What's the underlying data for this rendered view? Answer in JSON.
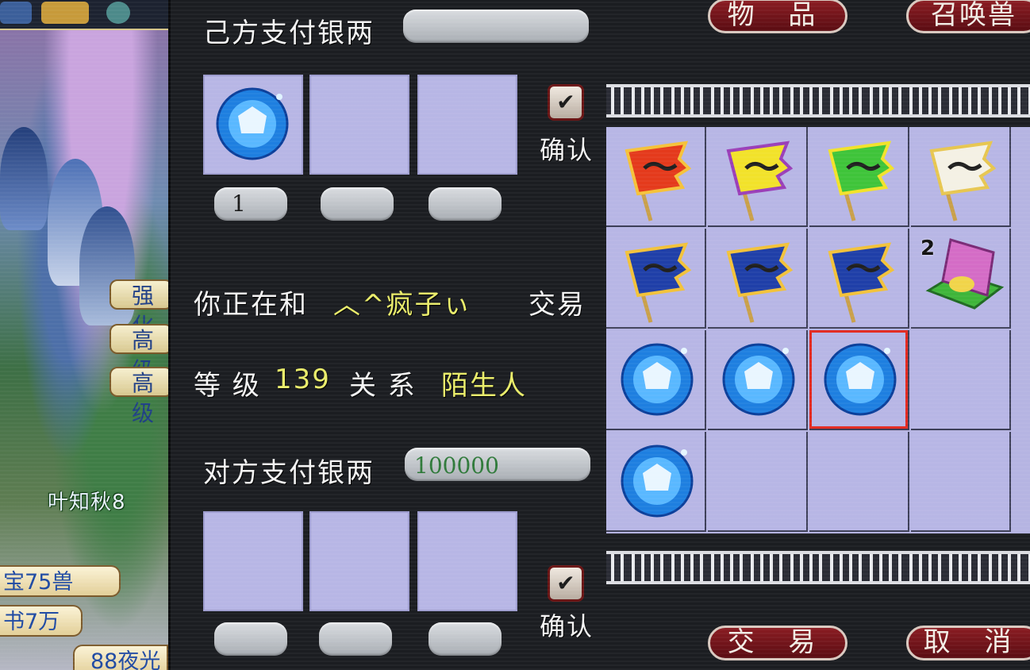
{
  "trade": {
    "self_pay_label": "己方支付银两",
    "self_pay_value": "",
    "self_slots": [
      {
        "item": "gem",
        "qty": "1"
      },
      {
        "item": "",
        "qty": ""
      },
      {
        "item": "",
        "qty": ""
      }
    ],
    "confirm_label": "确认",
    "trading_prefix": "你正在和",
    "partner_name": "︿^疯子ぃ",
    "trading_suffix": "交易",
    "level_label": "等 级",
    "level_value": "139",
    "relation_label": "关 系",
    "relation_value": "陌生人",
    "other_pay_label": "对方支付银两",
    "other_pay_value": "100000",
    "other_slots": [
      {
        "item": "",
        "qty": ""
      },
      {
        "item": "",
        "qty": ""
      },
      {
        "item": "",
        "qty": ""
      }
    ]
  },
  "tabs": {
    "items": "物 品",
    "pets": "召唤兽"
  },
  "buttons": {
    "trade": "交 易",
    "cancel": "取 消"
  },
  "inventory": {
    "cells": [
      {
        "item": "flag-red",
        "count": ""
      },
      {
        "item": "flag-yellow",
        "count": ""
      },
      {
        "item": "flag-green",
        "count": ""
      },
      {
        "item": "flag-white",
        "count": ""
      },
      {
        "item": "flag-blue",
        "count": ""
      },
      {
        "item": "flag-blue",
        "count": ""
      },
      {
        "item": "flag-blue",
        "count": ""
      },
      {
        "item": "gift-box",
        "count": "2"
      },
      {
        "item": "gem",
        "count": ""
      },
      {
        "item": "gem",
        "count": ""
      },
      {
        "item": "gem",
        "count": "",
        "selected": true
      },
      {
        "item": "",
        "count": ""
      },
      {
        "item": "gem",
        "count": ""
      },
      {
        "item": "",
        "count": ""
      },
      {
        "item": "",
        "count": ""
      },
      {
        "item": "",
        "count": ""
      }
    ]
  },
  "left_scene": {
    "chat_lines": [
      "叶知秋8"
    ],
    "tags": [
      "强化",
      "高级",
      "高级"
    ],
    "scroll_tags": [
      "宝75兽",
      "书7万",
      "88夜光"
    ]
  },
  "colors": {
    "slot_bg": "#b7b6e5",
    "highlight_text": "#e9ec6a",
    "button_red": "#8a1c22",
    "selection_border": "#e2281f"
  }
}
